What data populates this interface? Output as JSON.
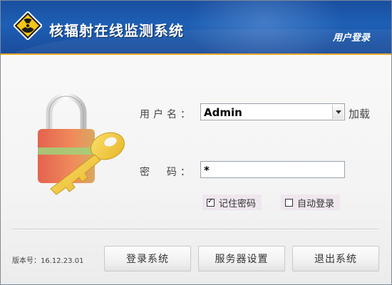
{
  "header": {
    "app_title": "核辐射在线监测系统",
    "subtitle": "用户登录",
    "logo_icon": "radiation-warning-icon",
    "colors": {
      "banner": "#1d5fb5",
      "accent": "#e7a82a"
    }
  },
  "form": {
    "username_label": "用户名：",
    "username_value": "Admin",
    "load_label": "加载",
    "password_label": "密  码：",
    "password_value": "*",
    "remember_label": "记住密码",
    "remember_checked": true,
    "autologin_label": "自动登录",
    "autologin_checked": false
  },
  "footer": {
    "version": "版本号：16.12.23.01",
    "login_button": "登录系统",
    "settings_button": "服务器设置",
    "exit_button": "退出系统"
  },
  "illustration": "lock-and-key-icon"
}
